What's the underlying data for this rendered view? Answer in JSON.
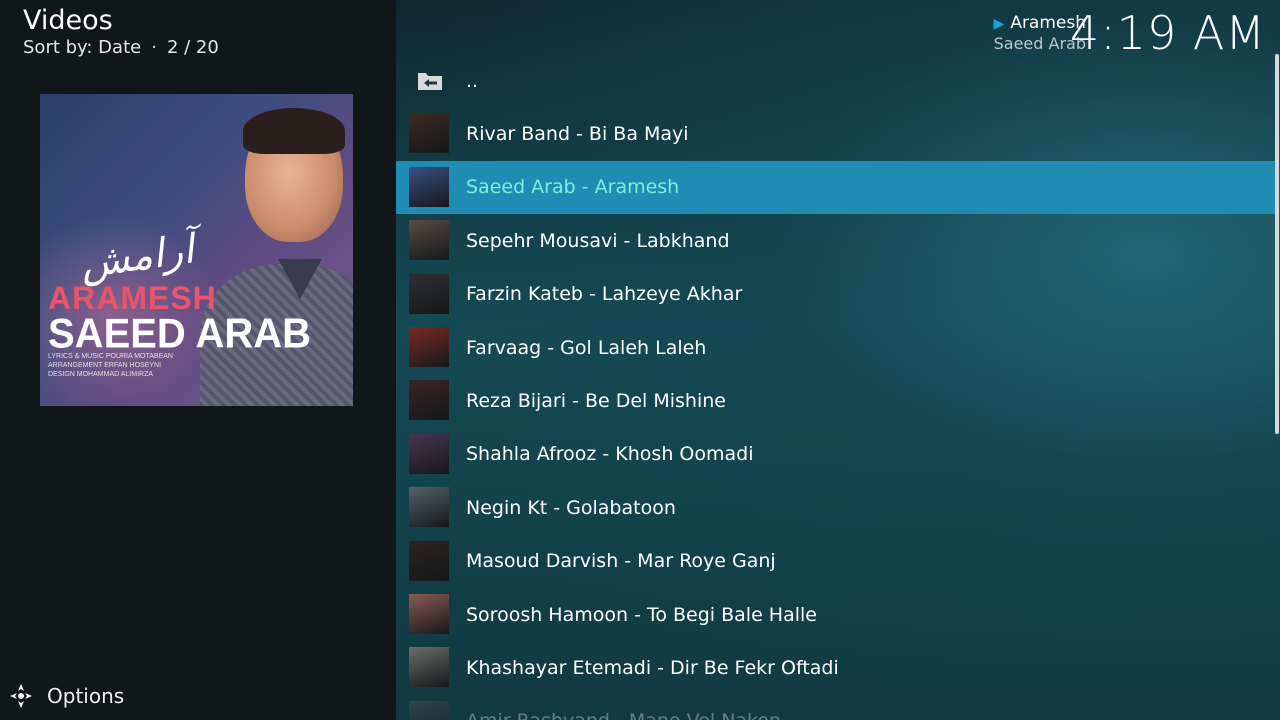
{
  "header": {
    "title": "Videos",
    "sort_label": "Sort by: Date",
    "position": "2 / 20"
  },
  "poster": {
    "farsi_title": "آرامش",
    "title1": "ARAMESH",
    "title2": "SAEED ARAB",
    "credit1": "LYRICS & MUSIC  POURIA MOTABEAN",
    "credit2": "ARRANGEMENT  ERFAN HOSEYNI",
    "credit3": "DESIGN  MOHAMMAD ALIMIRZA"
  },
  "now_playing": {
    "title": "Aramesh",
    "artist": "Saeed Arab"
  },
  "clock": "4:19 AM",
  "options_label": "Options",
  "list": {
    "parent_label": "..",
    "items": [
      {
        "label": "Rivar Band - Bi Ba Mayi",
        "thumb": "#3a2a22"
      },
      {
        "label": "Saeed Arab - Aramesh",
        "thumb": "#3a4f86"
      },
      {
        "label": "Sepehr Mousavi - Labkhand",
        "thumb": "#5b4a45"
      },
      {
        "label": "Farzin Kateb - Lahzeye Akhar",
        "thumb": "#2f2f33"
      },
      {
        "label": "Farvaag - Gol Laleh Laleh",
        "thumb": "#7a2a24"
      },
      {
        "label": "Reza Bijari - Be Del Mishine",
        "thumb": "#3b2326"
      },
      {
        "label": "Shahla Afrooz - Khosh Oomadi",
        "thumb": "#4a3550"
      },
      {
        "label": "Negin Kt - Golabatoon",
        "thumb": "#55606a"
      },
      {
        "label": "Masoud Darvish - Mar Roye Ganj",
        "thumb": "#2c2420"
      },
      {
        "label": "Soroosh Hamoon - To Begi Bale Halle",
        "thumb": "#8a5a58"
      },
      {
        "label": "Khashayar Etemadi - Dir Be Fekr Oftadi",
        "thumb": "#6a6e6a"
      },
      {
        "label": "Amir Rashvand - Mano Vel Nakon",
        "thumb": "#4a4e52"
      }
    ],
    "selected_index": 1
  },
  "colors": {
    "selection": "#1f8db3",
    "selected_text": "#7ff0d6",
    "accent": "#12a7d9"
  }
}
